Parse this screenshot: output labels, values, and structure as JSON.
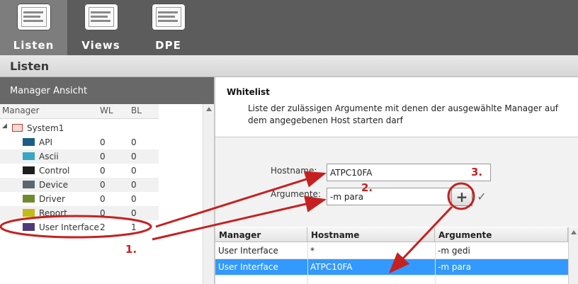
{
  "toolbar": {
    "items": [
      {
        "label": "Listen",
        "icon": "list-document-icon",
        "active": true
      },
      {
        "label": "Views",
        "icon": "list-document-icon",
        "active": false
      },
      {
        "label": "DPE",
        "icon": "list-document-icon",
        "active": false
      }
    ]
  },
  "page": {
    "title": "Listen"
  },
  "manager_panel": {
    "header": "Manager Ansicht",
    "columns": [
      "Manager",
      "WL",
      "BL"
    ],
    "root": {
      "label": "System1",
      "icon": "system-icon"
    },
    "items": [
      {
        "label": "API",
        "wl": "0",
        "bl": "0",
        "color": "#1a5e86"
      },
      {
        "label": "Ascii",
        "wl": "0",
        "bl": "0",
        "color": "#3aa6c4"
      },
      {
        "label": "Control",
        "wl": "0",
        "bl": "0",
        "color": "#1e1e1e"
      },
      {
        "label": "Device",
        "wl": "0",
        "bl": "0",
        "color": "#5b6670"
      },
      {
        "label": "Driver",
        "wl": "0",
        "bl": "0",
        "color": "#6f8a2e"
      },
      {
        "label": "Report",
        "wl": "0",
        "bl": "0",
        "color": "#c2bb1a"
      },
      {
        "label": "User Interface",
        "wl": "2",
        "bl": "1",
        "color": "#4e3a78"
      }
    ]
  },
  "whitelist": {
    "title": "Whitelist",
    "description": "Liste der zulässigen Argumente mit denen der ausgewählte Manager auf dem angegebenen Host starten darf",
    "hostname_label": "Hostname:",
    "hostname_value": "ATPC10FA",
    "argumente_label": "Argumente:",
    "argumente_value": "-m para",
    "add_symbol": "+",
    "ok_symbol": "✓",
    "table": {
      "columns": [
        "Manager",
        "Hostname",
        "Argumente"
      ],
      "rows": [
        {
          "manager": "User Interface",
          "hostname": "*",
          "argumente": "-m gedi",
          "selected": false
        },
        {
          "manager": "User Interface",
          "hostname": "ATPC10FA",
          "argumente": "-m para",
          "selected": true
        }
      ]
    }
  },
  "annotations": {
    "step1": "1.",
    "step2": "2.",
    "step3": "3.",
    "color": "#c62121"
  }
}
